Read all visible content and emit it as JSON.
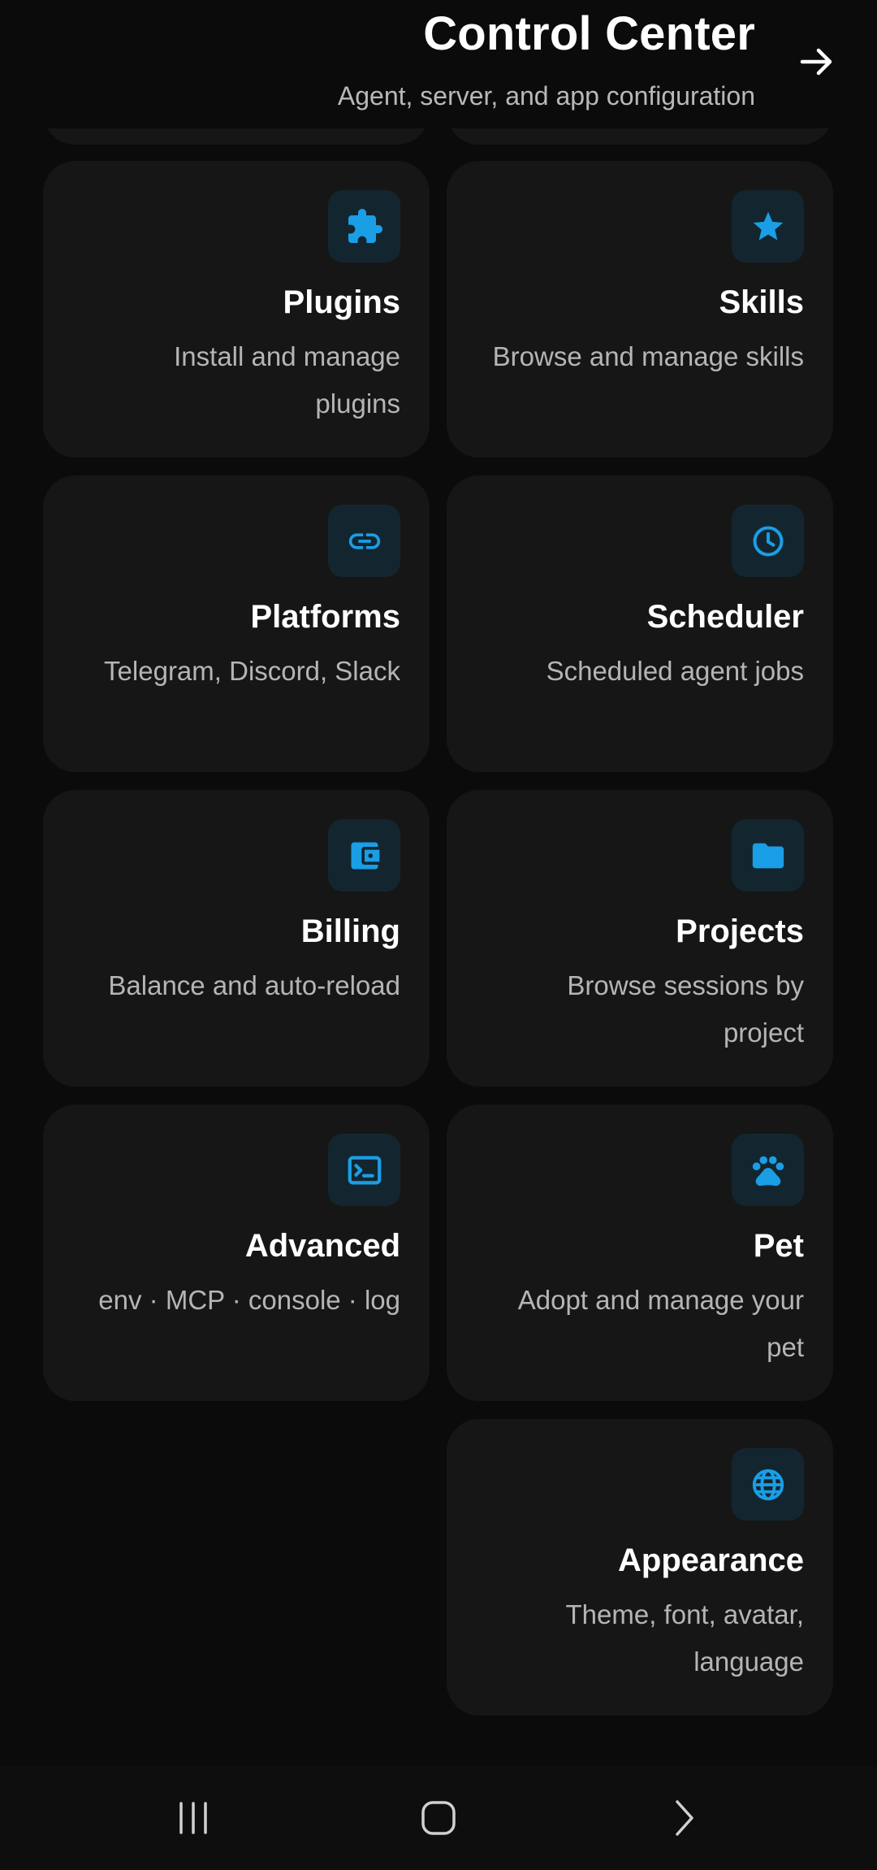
{
  "header": {
    "title": "Control Center",
    "subtitle": "Agent, server, and app configuration",
    "action_icon": "arrow-right-icon"
  },
  "accent_color": "#1a9ee6",
  "cards": [
    {
      "title": "Plugins",
      "description": "Install and manage plugins",
      "icon": "puzzle-icon"
    },
    {
      "title": "Skills",
      "description": "Browse and manage skills",
      "icon": "star-icon"
    },
    {
      "title": "Platforms",
      "description": "Telegram, Discord, Slack",
      "icon": "link-icon"
    },
    {
      "title": "Scheduler",
      "description": "Scheduled agent jobs",
      "icon": "clock-icon"
    },
    {
      "title": "Billing",
      "description": "Balance and auto-reload",
      "icon": "wallet-icon"
    },
    {
      "title": "Projects",
      "description": "Browse sessions by project",
      "icon": "folder-icon"
    },
    {
      "title": "Advanced",
      "description": "env · MCP · console · log",
      "icon": "terminal-icon"
    },
    {
      "title": "Pet",
      "description": "Adopt and manage your pet",
      "icon": "paw-icon"
    },
    {
      "title": "Appearance",
      "description": "Theme, font, avatar, language",
      "icon": "globe-icon"
    }
  ],
  "navbar": {
    "recents_icon": "recents-icon",
    "home_icon": "home-icon",
    "back_icon": "back-chevron-icon"
  }
}
